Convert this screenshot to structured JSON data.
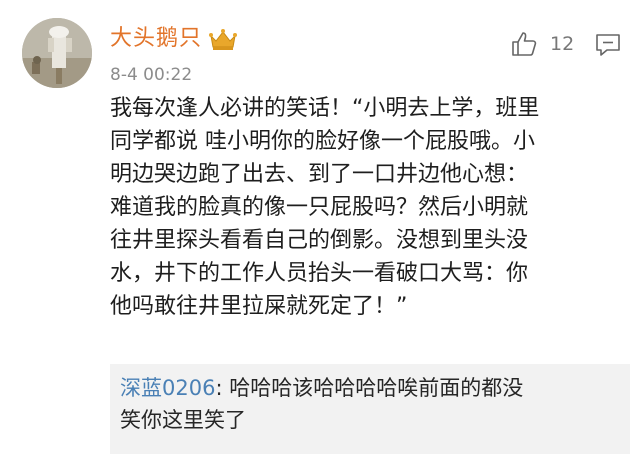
{
  "comment": {
    "username": "大头鹅只",
    "badge_icon": "crown-icon",
    "timestamp": "8-4 00:22",
    "likes": "12",
    "like_icon": "thumbs-up-icon",
    "reply_icon": "comment-icon",
    "content_lines": [
      "我每次逢人必讲的笑话！“小明去上学，班里",
      "同学都说 哇小明你的脸好像一个屁股哦。小",
      "明边哭边跑了出去、到了一口井边他心想：",
      "难道我的脸真的像一只屁股吗？然后小明就",
      "往井里探头看看自己的倒影。没想到里头没",
      "水，井下的工作人员抬头一看破口大骂：你",
      "他吗敢往井里拉屎就死定了！”"
    ],
    "reply": {
      "author": "深蓝0206",
      "separator": ": ",
      "text_line1": "哈哈哈该哈哈哈哈唉前面的都没",
      "text_line2": "笑你这里笑了"
    }
  },
  "colors": {
    "username": "#e2742a",
    "reply_author": "#4a80b5",
    "reply_background": "#f2f2f2",
    "timestamp": "#8c8c8c",
    "crown": "#e9a72b"
  }
}
